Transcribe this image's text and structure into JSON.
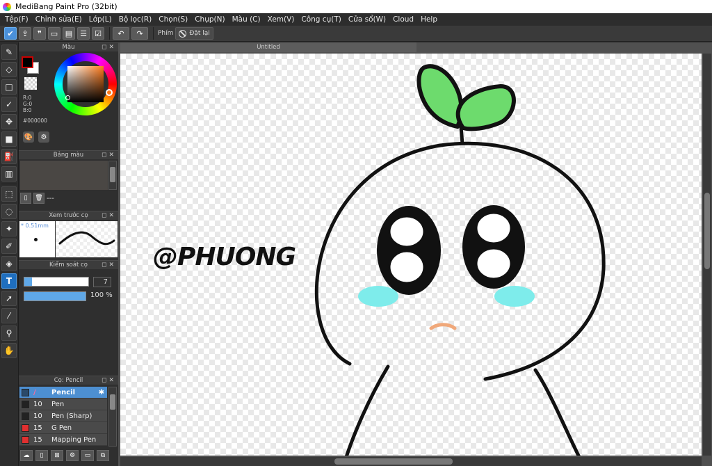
{
  "window": {
    "title": "MediBang Paint Pro (32bit)"
  },
  "menu": [
    "Tệp(F)",
    "Chỉnh sửa(E)",
    "Lớp(L)",
    "Bộ lọc(R)",
    "Chọn(S)",
    "Chụp(N)",
    "Màu (C)",
    "Xem(V)",
    "Công cụ(T)",
    "Cửa sổ(W)",
    "Cloud",
    "Help"
  ],
  "toolbar": {
    "key_label": "Phím",
    "reset_label": "Đặt lại"
  },
  "panels": {
    "color": {
      "title": "Màu",
      "r": "R:0",
      "g": "G:0",
      "b": "B:0",
      "hex": "#000000"
    },
    "palette": {
      "title": "Bảng màu",
      "empty": "---"
    },
    "preview": {
      "title": "Xem trước cọ",
      "size": "* 0.51mm"
    },
    "control": {
      "title": "Kiểm soát cọ",
      "size_value": "7",
      "opacity_value": "100 %",
      "size_fraction": 0.07,
      "opacity_fraction": 1.0
    },
    "brush": {
      "title": "Cọ: Pencil",
      "items": [
        {
          "size": "/",
          "name": "Pencil",
          "color": "#2a4a6a"
        },
        {
          "size": "10",
          "name": "Pen",
          "color": "#222222"
        },
        {
          "size": "10",
          "name": "Pen (Sharp)",
          "color": "#222222"
        },
        {
          "size": "15",
          "name": "G Pen",
          "color": "#e03030"
        },
        {
          "size": "15",
          "name": "Mapping Pen",
          "color": "#e03030"
        }
      ]
    }
  },
  "document": {
    "tab": "Untitled",
    "watermark": "@PHUONG"
  },
  "colors": {
    "leaf": "#6ddb6d",
    "cheek": "#7eeceb",
    "mouth": "#f0a87a",
    "selected": "#4d8fd1"
  }
}
